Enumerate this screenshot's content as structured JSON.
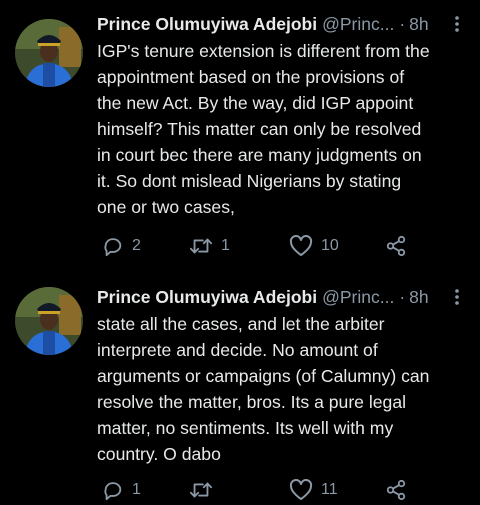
{
  "tweets": [
    {
      "author_name": "Prince Olumuyiwa Adejobi",
      "handle": "@Princ...",
      "separator": "·",
      "time": "8h",
      "text": "IGP's tenure extension is different from the\nappointment based on the provisions of\nthe new Act. By the way, did IGP appoint\nhimself? This matter can only be resolved\nin court bec there are many judgments on\nit. So dont mislead Nigerians by stating\none or two cases,",
      "reply_count": "2",
      "retweet_count": "1",
      "like_count": "10"
    },
    {
      "author_name": "Prince Olumuyiwa Adejobi",
      "handle": "@Princ...",
      "separator": "·",
      "time": "8h",
      "text": "state all the cases, and let the arbiter\ninterprete and decide. No amount of\narguments or campaigns (of Calumny) can\nresolve the matter, bros. Its a pure legal\nmatter, no sentiments. Its well with my\ncountry. O dabo",
      "reply_count": "1",
      "retweet_count": "",
      "like_count": "11"
    }
  ],
  "icons": {
    "reply": "reply-icon",
    "retweet": "retweet-icon",
    "like": "heart-icon",
    "share": "share-icon",
    "more": "more-vertical-icon"
  },
  "colors": {
    "background": "#000000",
    "text": "#e7e9ea",
    "secondary": "#8b98a5"
  }
}
